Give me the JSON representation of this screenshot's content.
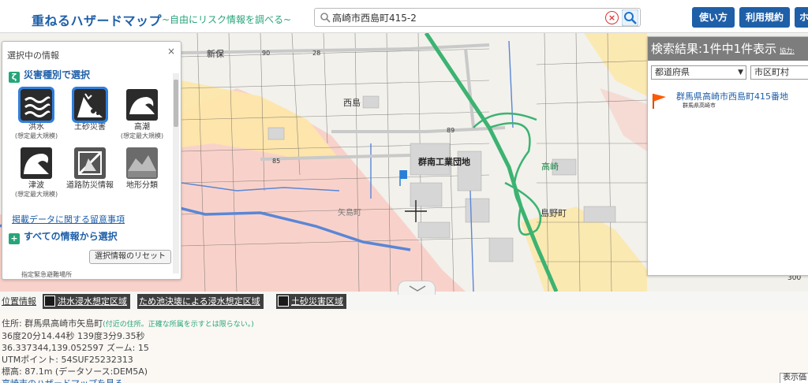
{
  "header": {
    "logo": "重ねるハザードマップ",
    "tagline": "~自由にリスク情報を調べる~",
    "search_value": "高崎市西島町415-2",
    "clear_label": "×",
    "buttons": {
      "usage": "使い方",
      "terms": "利用規約",
      "home": "ホ"
    }
  },
  "left_panel": {
    "title": "選択中の情報",
    "close_label": "×",
    "section_by_type": "災害種別で選択",
    "section_icon": "ζ",
    "hazards": [
      {
        "label": "洪水",
        "sub": "(想定最大規模)",
        "icon": "flood-icon",
        "selected": true
      },
      {
        "label": "土砂災害",
        "sub": "",
        "icon": "landslide-icon",
        "selected": true
      },
      {
        "label": "高潮",
        "sub": "(想定最大規模)",
        "icon": "storm-surge-icon",
        "selected": false
      },
      {
        "label": "津波",
        "sub": "(想定最大規模)",
        "icon": "tsunami-icon",
        "selected": false
      },
      {
        "label": "道路防災情報",
        "sub": "",
        "icon": "road-disaster-icon",
        "selected": false
      },
      {
        "label": "地形分類",
        "sub": "",
        "icon": "terrain-icon",
        "selected": false
      }
    ],
    "notes_link": "掲載データに関する留意事項",
    "section_all": "すべての情報から選択",
    "section_all_icon": "+",
    "reset_button": "選択情報のリセット",
    "footer_text": "指定緊急避難場所"
  },
  "right_panel": {
    "header": "検索結果:1件中1件表示",
    "header_small": "協力:",
    "prefecture_select": "都道府県",
    "city_select": "市区町村",
    "result_title": "群馬県高崎市西島町415番地",
    "result_sub": "群馬県高崎市"
  },
  "map": {
    "labels": {
      "shinbo": "新保",
      "nishijima": "西島",
      "gunnan": "群南工業団地",
      "takasaki": "高崎",
      "shimano": "島野町",
      "yajima": "矢島町"
    },
    "road_numbers": [
      "90",
      "89",
      "85",
      "28"
    ],
    "scale_hint": "300"
  },
  "bottom": {
    "tab_location": "位置情報",
    "tabs": [
      "洪水浸水想定区域",
      "ため池決壊による浸水想定区域",
      "土砂災害区域"
    ],
    "address": "住所: 群馬県高崎市矢島町",
    "address_note": "(付近の住所。正確な所属を示すとは限らない。)",
    "dms": "36度20分14.44秒 139度3分9.35秒",
    "latlon_zoom": "36.337344,139.052597 ズーム: 15",
    "utm": "UTMポイント: 54SUF25232313",
    "elevation": "標高: 87.1m (データソース:DEM5A)",
    "hazard_link": "高崎市のハザードマップを見る",
    "display_button": "表示価"
  },
  "colors": {
    "brand_blue": "#1e5fa8",
    "accent_green": "#27a57a",
    "flood_light": "#fde7a8",
    "flood_pink": "#f9cdc4",
    "expressway": "#3cb371",
    "river": "#5a86d6"
  }
}
